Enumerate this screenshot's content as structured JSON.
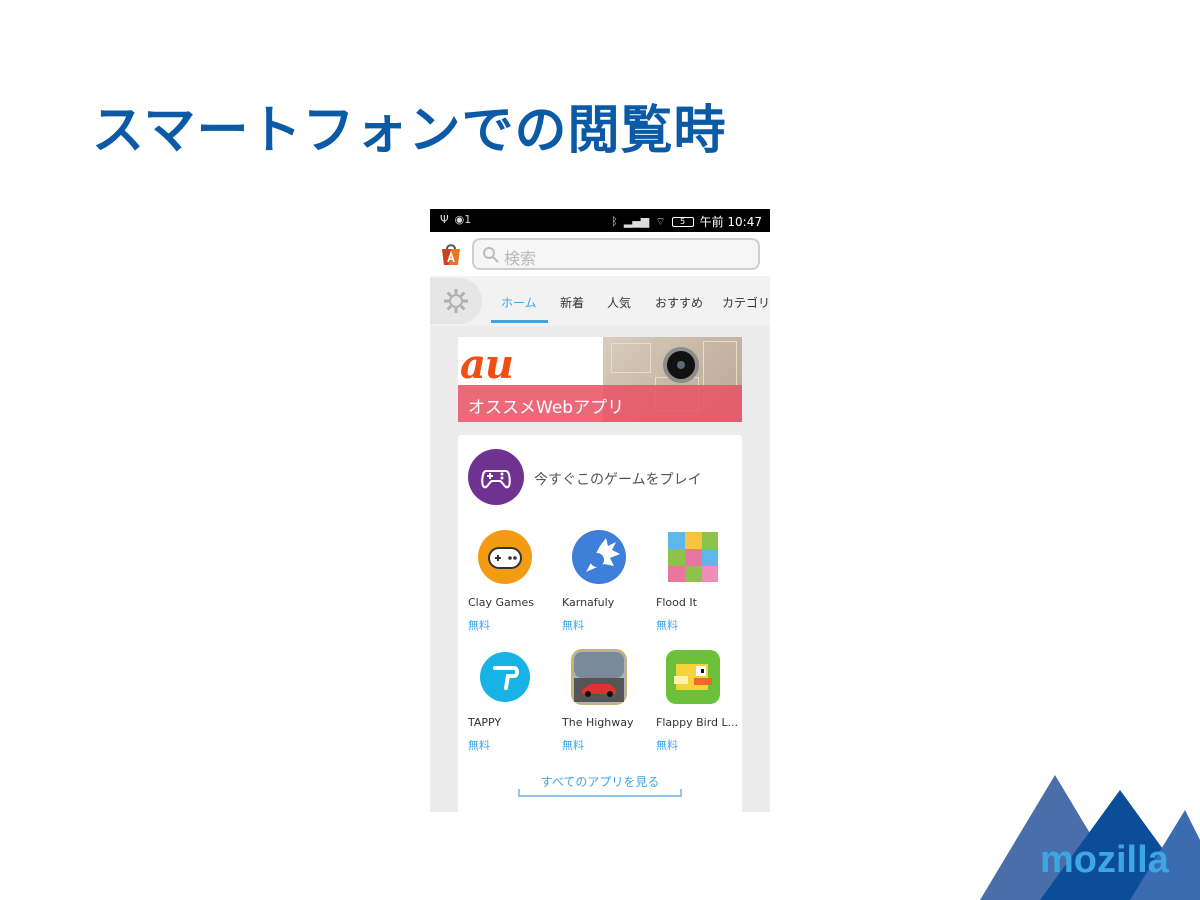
{
  "slide": {
    "title": "スマートフォンでの閲覧時"
  },
  "status_bar": {
    "notification_count": "1",
    "time": "午前 10:47",
    "battery": "5"
  },
  "search": {
    "placeholder": "検索"
  },
  "tabs": [
    {
      "label": "ホーム",
      "active": true
    },
    {
      "label": "新着",
      "active": false
    },
    {
      "label": "人気",
      "active": false
    },
    {
      "label": "おすすめ",
      "active": false
    },
    {
      "label": "カテゴリ",
      "active": false
    }
  ],
  "banner": {
    "logo_text": "au",
    "text": "オススメWebアプリ"
  },
  "section": {
    "title": "今すぐこのゲームをプレイ",
    "apps": [
      {
        "name": "Clay Games",
        "price": "無料",
        "icon": "clay-games-icon",
        "color": "#f39b14"
      },
      {
        "name": "Karnafuly",
        "price": "無料",
        "icon": "karnafuly-icon",
        "color": "#3d7fd9"
      },
      {
        "name": "Flood It",
        "price": "無料",
        "icon": "flood-it-icon",
        "color": "#8dc34a"
      },
      {
        "name": "TAPPY",
        "price": "無料",
        "icon": "tappy-icon",
        "color": "#17b2e6"
      },
      {
        "name": "The Highway",
        "price": "無料",
        "icon": "highway-icon",
        "color": "#7a8a9a"
      },
      {
        "name": "Flappy Bird L...",
        "price": "無料",
        "icon": "flappy-bird-icon",
        "color": "#6cc03a"
      }
    ],
    "see_all_label": "すべてのアプリを見る"
  },
  "branding": {
    "logo_text": "mozilla"
  }
}
